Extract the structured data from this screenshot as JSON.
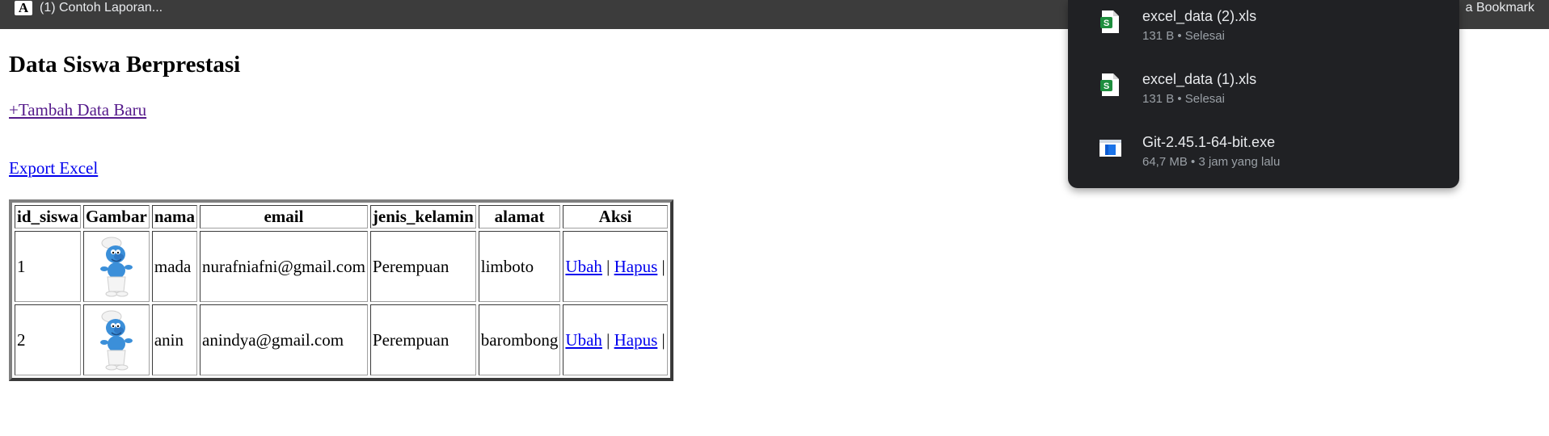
{
  "bookmark_bar": {
    "item_label": "(1) Contoh Laporan...",
    "favicon_letter": "A",
    "right_label": "a Bookmark"
  },
  "page": {
    "title": "Data Siswa Berprestasi",
    "add_link": "+Tambah Data Baru",
    "export_link": "Export Excel"
  },
  "table": {
    "headers": [
      "id_siswa",
      "Gambar",
      "nama",
      "email",
      "jenis_kelamin",
      "alamat",
      "Aksi"
    ],
    "rows": [
      {
        "id": "1",
        "nama": "mada",
        "email": "nurafniafni@gmail.com",
        "jenis_kelamin": "Perempuan",
        "alamat": "limboto",
        "edit": "Ubah",
        "sep": "|",
        "delete": "Hapus",
        "trail": "|"
      },
      {
        "id": "2",
        "nama": "anin",
        "email": "anindya@gmail.com",
        "jenis_kelamin": "Perempuan",
        "alamat": "barombong",
        "edit": "Ubah",
        "sep": "|",
        "delete": "Hapus",
        "trail": "|"
      }
    ]
  },
  "downloads": {
    "items": [
      {
        "name": "excel_data (2).xls",
        "meta": "131 B • Selesai",
        "icon": "spreadsheet-icon"
      },
      {
        "name": "excel_data (1).xls",
        "meta": "131 B • Selesai",
        "icon": "spreadsheet-icon"
      },
      {
        "name": "Git-2.45.1-64-bit.exe",
        "meta": "64,7 MB • 3 jam yang lalu",
        "icon": "installer-icon"
      }
    ]
  },
  "colors": {
    "bookmark_bar": "#3c3c3c",
    "downloads_bg": "#202124",
    "link": "#0000ee",
    "visited_link": "#551a8b",
    "sheet_icon": "#1e8e3e"
  }
}
